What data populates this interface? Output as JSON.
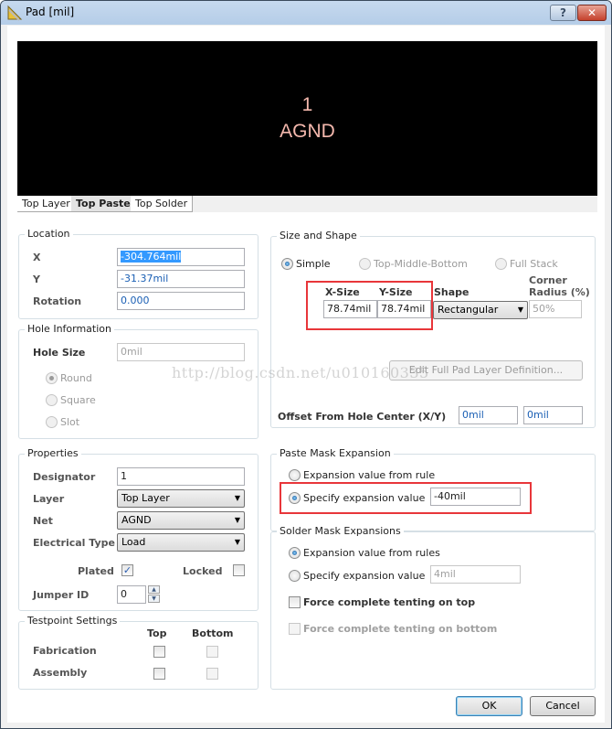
{
  "window": {
    "title": "Pad [mil]",
    "help_label": "?",
    "close_label": "✕"
  },
  "preview": {
    "designator": "1",
    "net": "AGND",
    "text_color": "#f4b8ad"
  },
  "layer_tabs": [
    {
      "label": "Top Layer",
      "active": false
    },
    {
      "label": "Top Paste",
      "active": true
    },
    {
      "label": "Top Solder",
      "active": false
    }
  ],
  "location": {
    "title": "Location",
    "x_label": "X",
    "x_value": "-304.764mil",
    "y_label": "Y",
    "y_value": "-31.37mil",
    "rotation_label": "Rotation",
    "rotation_value": "0.000"
  },
  "hole_information": {
    "title": "Hole Information",
    "hole_size_label": "Hole Size",
    "hole_size_value": "0mil",
    "shapes": [
      {
        "label": "Round",
        "checked": true
      },
      {
        "label": "Square",
        "checked": false
      },
      {
        "label": "Slot",
        "checked": false
      }
    ]
  },
  "properties": {
    "title": "Properties",
    "designator_label": "Designator",
    "designator_value": "1",
    "layer_label": "Layer",
    "layer_value": "Top Layer",
    "net_label": "Net",
    "net_value": "AGND",
    "electrical_type_label": "Electrical Type",
    "electrical_type_value": "Load",
    "plated_label": "Plated",
    "plated_checked": true,
    "locked_label": "Locked",
    "locked_checked": false,
    "jumper_id_label": "Jumper ID",
    "jumper_id_value": "0"
  },
  "testpoint": {
    "title": "Testpoint Settings",
    "top_label": "Top",
    "bottom_label": "Bottom",
    "rows": [
      {
        "label": "Fabrication",
        "top": false,
        "bottom": false
      },
      {
        "label": "Assembly",
        "top": false,
        "bottom": false
      }
    ]
  },
  "size_shape": {
    "title": "Size and Shape",
    "modes": [
      {
        "label": "Simple",
        "checked": true,
        "enabled": true
      },
      {
        "label": "Top-Middle-Bottom",
        "checked": false,
        "enabled": false
      },
      {
        "label": "Full Stack",
        "checked": false,
        "enabled": false
      }
    ],
    "x_size_label": "X-Size",
    "x_size_value": "78.74mil",
    "y_size_label": "Y-Size",
    "y_size_value": "78.74mil",
    "shape_label": "Shape",
    "shape_value": "Rectangular",
    "corner_radius_label_1": "Corner",
    "corner_radius_label_2": "Radius (%)",
    "corner_radius_value": "50%",
    "edit_full_pad_label": "Edit Full Pad Layer Definition...",
    "offset_label": "Offset From Hole Center (X/Y)",
    "offset_x_value": "0mil",
    "offset_y_value": "0mil"
  },
  "paste_mask": {
    "title": "Paste Mask Expansion",
    "from_rule_label": "Expansion value from rule",
    "from_rule_checked": false,
    "specify_label": "Specify expansion value",
    "specify_checked": true,
    "specify_value": "-40mil"
  },
  "solder_mask": {
    "title": "Solder Mask Expansions",
    "from_rules_label": "Expansion value from rules",
    "from_rules_checked": true,
    "specify_label": "Specify expansion value",
    "specify_checked": false,
    "specify_value": "4mil",
    "tent_top_label": "Force complete tenting on top",
    "tent_top_checked": false,
    "tent_bottom_label": "Force complete tenting on bottom",
    "tent_bottom_checked": false
  },
  "buttons": {
    "ok_label": "OK",
    "cancel_label": "Cancel"
  },
  "watermark": "http://blog.csdn.net/u010160335",
  "colors": {
    "highlight": "#e8363a",
    "value_blue": "#1a5fb4",
    "selection": "#3399ff"
  }
}
